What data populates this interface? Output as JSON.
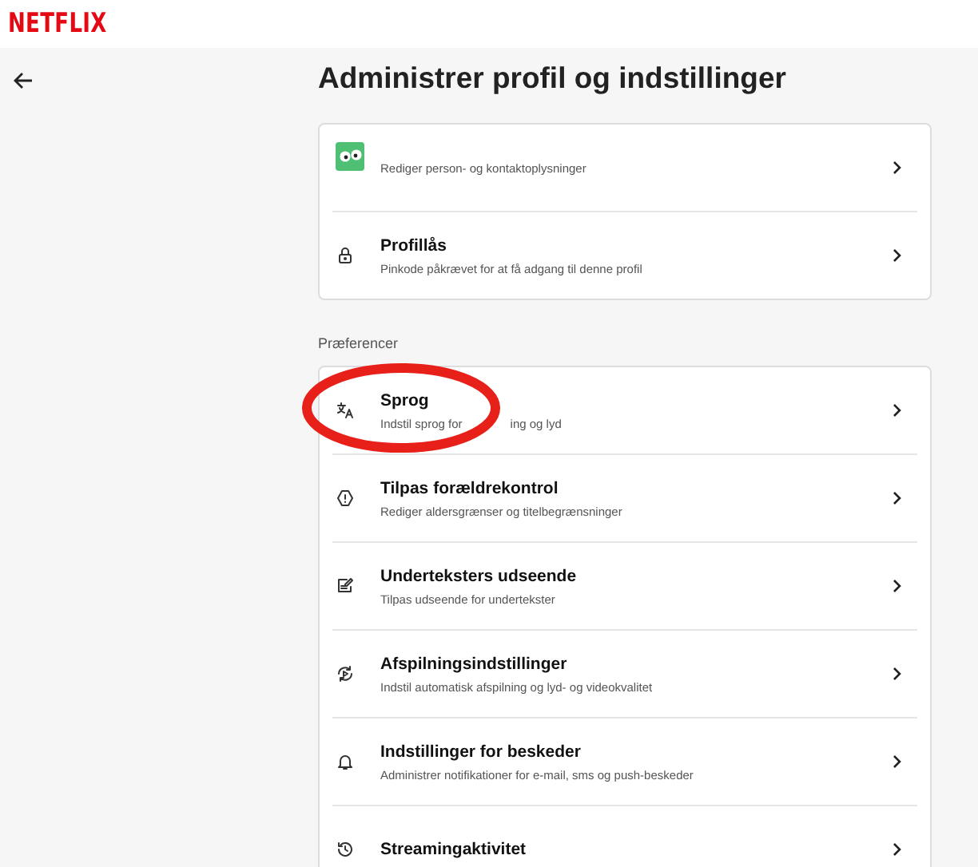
{
  "header": {
    "logo": "NETFLIX"
  },
  "page": {
    "title": "Administrer profil og indstillinger"
  },
  "profile_card": [
    {
      "kind": "avatar",
      "subtitle": "Rediger person- og kontaktoplysninger"
    },
    {
      "kind": "lock",
      "title": "Profillås",
      "subtitle": "Pinkode påkrævet for at få adgang til denne profil"
    }
  ],
  "preferences": {
    "heading": "Præferencer",
    "items": [
      {
        "kind": "language",
        "title": "Sprog",
        "subtitle": "Indstil sprog for",
        "subtitle_end": "ing og lyd",
        "circled": true
      },
      {
        "kind": "warning",
        "title": "Tilpas forældrekontrol",
        "subtitle": "Rediger aldersgrænser og titelbegrænsninger",
        "circled": false
      },
      {
        "kind": "subtitles",
        "title": "Underteksters udseende",
        "subtitle": "Tilpas udseende for undertekster",
        "circled": false
      },
      {
        "kind": "playback",
        "title": "Afspilningsindstillinger",
        "subtitle": "Indstil automatisk afspilning og lyd- og videokvalitet",
        "circled": false
      },
      {
        "kind": "bell",
        "title": "Indstillinger for beskeder",
        "subtitle": "Administrer notifikationer for e-mail, sms og push-beskeder",
        "circled": false
      },
      {
        "kind": "history",
        "title": "Streamingaktivitet",
        "circled": false
      }
    ]
  }
}
